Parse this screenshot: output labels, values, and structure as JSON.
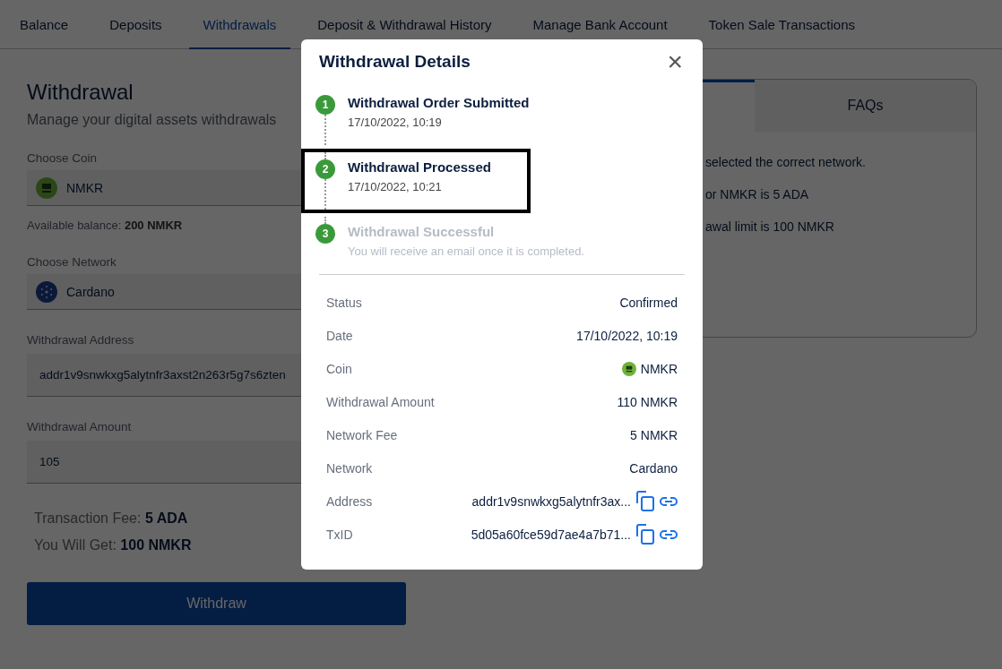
{
  "tabs": [
    {
      "label": "Balance",
      "selected": false
    },
    {
      "label": "Deposits",
      "selected": false
    },
    {
      "label": "Withdrawals",
      "selected": true
    },
    {
      "label": "Deposit & Withdrawal History",
      "selected": false
    },
    {
      "label": "Manage Bank Account",
      "selected": false
    },
    {
      "label": "Token Sale Transactions",
      "selected": false
    }
  ],
  "withdrawal_form": {
    "title": "Withdrawal",
    "subtitle": "Manage your digital assets withdrawals",
    "coin": {
      "label": "Choose Coin",
      "value": "NMKR"
    },
    "balance": "Available balance: **200 NMKR**",
    "network": {
      "label": "Choose Network",
      "value": "Cardano"
    },
    "address": {
      "label": "Withdrawal Address",
      "value": "addr1v9snwkxg5alytnfr3axst2n263r5g7s6zten"
    },
    "amount": {
      "label": "Withdrawal Amount",
      "value": "105"
    },
    "summary": [
      "Transaction Fee: **5 ADA**",
      "You Will Get: **100 NMKR**"
    ],
    "button": "Withdraw"
  },
  "info_panel": {
    "tabs": [
      {
        "selected": true
      },
      {
        "label": "FAQs",
        "selected": false
      }
    ],
    "lines": [
      "selected the correct network.",
      "or NMKR is 5 ADA",
      "awal limit is 100 NMKR"
    ]
  },
  "modal": {
    "title": "Withdrawal Details",
    "close": "×",
    "steps": [
      {
        "number": "1",
        "title": "Withdrawal Order Submitted",
        "detail": "17/10/2022, 10:19",
        "done": true,
        "highlighted": false
      },
      {
        "number": "2",
        "title": "Withdrawal Processed",
        "detail": "17/10/2022, 10:21",
        "done": true,
        "highlighted": true
      },
      {
        "number": "3",
        "title": "Withdrawal Successful",
        "detail": "You will receive an email once it is completed.",
        "done": false,
        "highlighted": false
      }
    ],
    "details": [
      {
        "kind": "text",
        "label": "Status",
        "value": "Confirmed"
      },
      {
        "kind": "text",
        "label": "Date",
        "value": "17/10/2022, 10:19"
      },
      {
        "kind": "coin",
        "label": "Coin",
        "value": "NMKR"
      },
      {
        "kind": "text",
        "label": "Withdrawal Amount",
        "value": "110 NMKR"
      },
      {
        "kind": "text",
        "label": "Network Fee",
        "value": "5 NMKR"
      },
      {
        "kind": "text",
        "label": "Network",
        "value": "Cardano"
      },
      {
        "kind": "copy",
        "label": "Address",
        "value": "addr1v9snwkxg5alytnfr3ax..."
      },
      {
        "kind": "copy",
        "label": "TxID",
        "value": "5d05a60fce59d7ae4a7b71..."
      }
    ]
  }
}
